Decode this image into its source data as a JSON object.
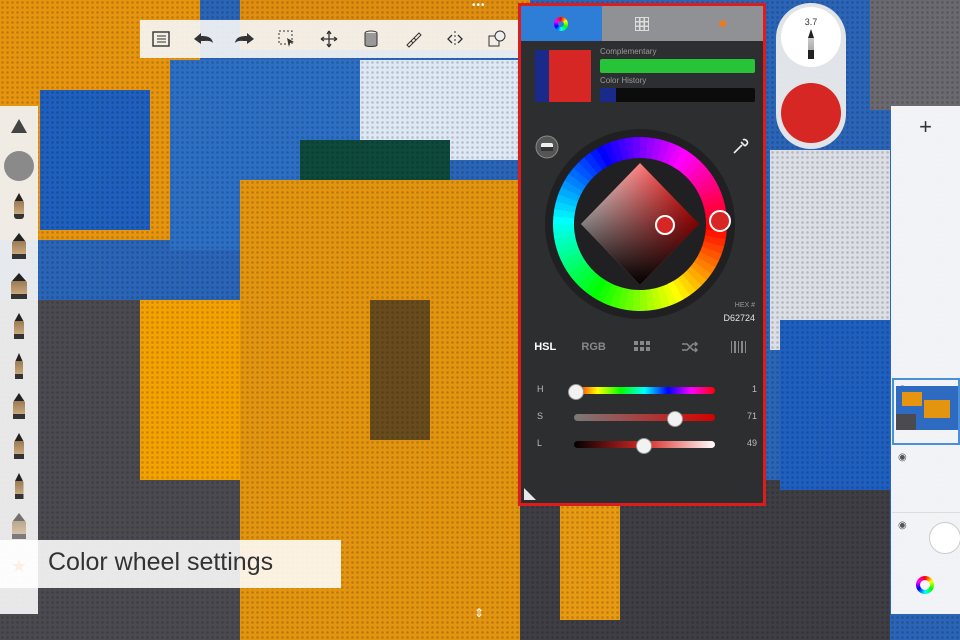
{
  "toolbar": {
    "buttons": [
      "list-icon",
      "undo-icon",
      "redo-icon",
      "select-icon",
      "transform-icon",
      "fill-icon",
      "ruler-icon",
      "symmetry-icon",
      "stencil-icon"
    ]
  },
  "caption": {
    "text": "Color wheel settings"
  },
  "color_panel": {
    "tabs": [
      "color-wheel-icon",
      "swatch-grid-icon",
      "favorites-star-icon"
    ],
    "complementary_label": "Complementary",
    "color_history_label": "Color History",
    "hex_label": "HEX #",
    "hex_value": "D62724",
    "modes": [
      "HSL",
      "RGB",
      "grid-icon",
      "shuffle-icon",
      "barcode-icon"
    ],
    "active_mode": "HSL",
    "sliders": [
      {
        "label": "H",
        "value": "1",
        "fraction": 0.01
      },
      {
        "label": "S",
        "value": "71",
        "fraction": 0.71
      },
      {
        "label": "L",
        "value": "49",
        "fraction": 0.49
      }
    ],
    "current_color": "#d62724",
    "complementary_color": "#27c43a"
  },
  "brush_pill": {
    "size_value": "3.7"
  },
  "layers": {
    "add_label": "+"
  }
}
